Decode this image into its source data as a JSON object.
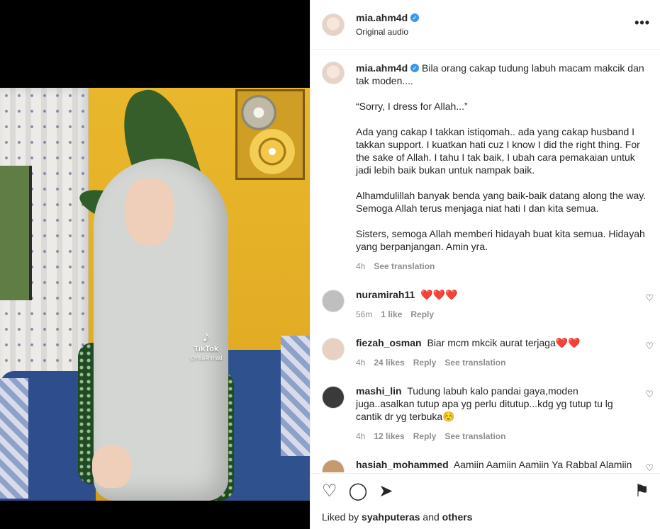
{
  "post": {
    "username": "mia.ahm4d",
    "subtitle": "Original audio",
    "more_label": "•••"
  },
  "media": {
    "watermark_brand": "TikTok",
    "watermark_handle": "@mia4hmad"
  },
  "caption": {
    "username": "mia.ahm4d",
    "paragraphs": [
      "Bila orang cakap tudung labuh macam makcik dan tak moden....",
      "“Sorry, I dress for Allah...”",
      "Ada yang cakap I takkan istiqomah.. ada yang cakap husband I takkan support. I kuatkan hati cuz I know I did the right thing. For the sake of Allah. I tahu I tak baik, I ubah cara pemakaian untuk jadi lebih baik bukan untuk nampak baik.",
      "Alhamdulillah banyak benda yang baik-baik datang along the way. Semoga Allah terus menjaga niat hati I dan kita semua.",
      "Sisters, semoga Allah memberi hidayah buat kita semua. Hidayah yang berpanjangan. Amin yra."
    ],
    "time": "4h",
    "see_translation": "See translation"
  },
  "comments": [
    {
      "user": "nuramirah11",
      "text": "❤️❤️❤️",
      "time": "56m",
      "likes": "1 like",
      "reply": "Reply",
      "translate": ""
    },
    {
      "user": "fiezah_osman",
      "text": "Biar mcm mkcik aurat terjaga❤️❤️",
      "time": "4h",
      "likes": "24 likes",
      "reply": "Reply",
      "translate": "See translation"
    },
    {
      "user": "mashi_lin",
      "text": "Tudung labuh kalo pandai gaya,moden juga..asalkan tutup apa yg perlu ditutup...kdg yg tutup tu lg cantik dr yg terbuka☺️",
      "time": "4h",
      "likes": "12 likes",
      "reply": "Reply",
      "translate": "See translation"
    },
    {
      "user": "hasiah_mohammed",
      "text": "Aamiin Aamiin Aamiin Ya Rabbal Alamiin ❤️❤️❤️❤️",
      "time": "",
      "likes": "",
      "reply": "",
      "translate": ""
    }
  ],
  "icons": {
    "like": "heart-icon",
    "comment": "comment-icon",
    "share": "share-icon",
    "save": "bookmark-icon"
  },
  "likes": {
    "prefix": "Liked by",
    "user": "syahputeras",
    "and": "and",
    "others": "others"
  }
}
